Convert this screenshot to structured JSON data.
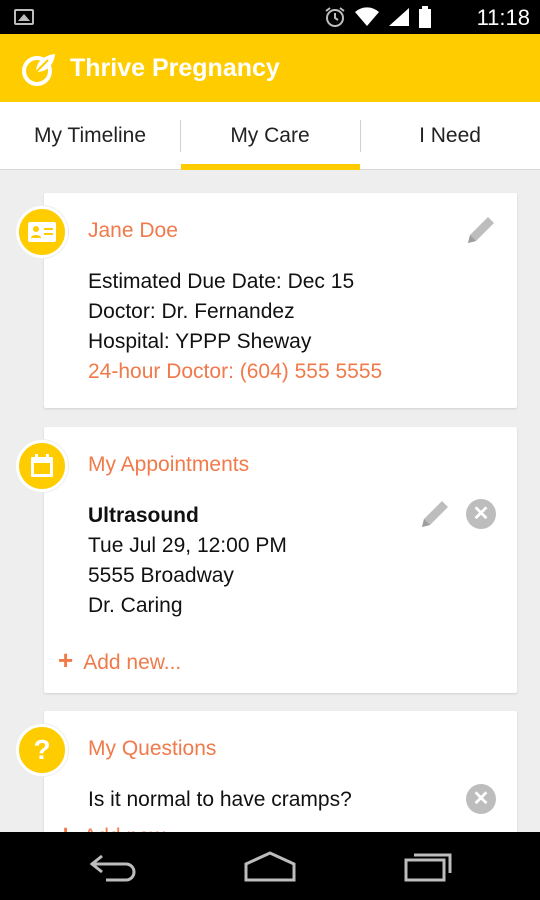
{
  "status_bar": {
    "time": "11:18",
    "icons": [
      "gallery-icon",
      "alarm-icon",
      "wifi-icon",
      "signal-icon",
      "battery-icon"
    ]
  },
  "app_bar": {
    "title": "Thrive Pregnancy",
    "accent": "#ffcc00"
  },
  "tabs": [
    {
      "label": "My Timeline",
      "selected": false
    },
    {
      "label": "My Care",
      "selected": true
    },
    {
      "label": "I Need",
      "selected": false
    }
  ],
  "profile": {
    "name": "Jane Doe",
    "due_date": "Estimated Due Date: Dec 15",
    "doctor": "Doctor: Dr. Fernandez",
    "hospital": "Hospital: YPPP Sheway",
    "hotline": "24-hour Doctor: (604) 555 5555"
  },
  "appointments": {
    "title": "My Appointments",
    "items": [
      {
        "name": "Ultrasound",
        "datetime": "Tue Jul 29, 12:00 PM",
        "address": "5555 Broadway",
        "doctor": "Dr. Caring"
      }
    ],
    "add_label": "Add new..."
  },
  "questions": {
    "title": "My Questions",
    "items": [
      {
        "text": "Is it normal to have cramps?"
      }
    ],
    "add_label": "Add new..."
  },
  "colors": {
    "accent": "#ffcc00",
    "link": "#f07a4a",
    "icon_grey": "#bdbdbd"
  }
}
